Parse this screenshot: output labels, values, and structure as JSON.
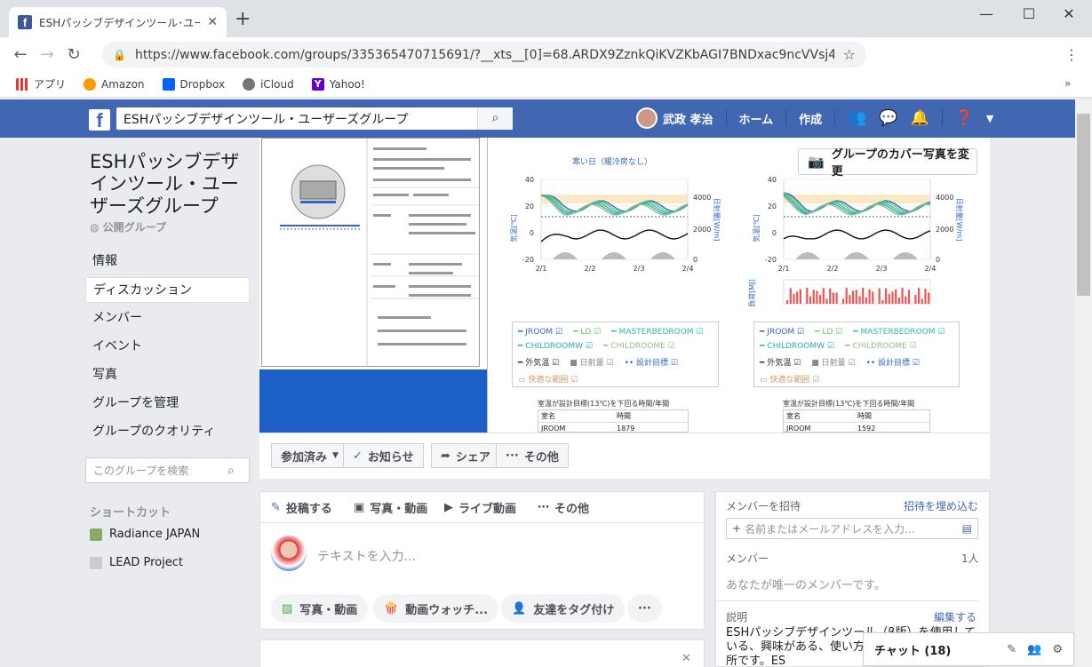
{
  "browser": {
    "tab_title": "ESHパッシブデザインツール･ユーザーズ",
    "url": "https://www.facebook.com/groups/335365470715691/?__xts__[0]=68.ARDX9ZznkQiKVZKbAGI7BNDxac9ncVVsj4qqfVlvRFebJw...",
    "bookmarks": [
      "アプリ",
      "Amazon",
      "Dropbox",
      "iCloud",
      "Yahoo!"
    ]
  },
  "fb": {
    "search_value": "ESHパッシブデザインツール・ユーザーズグループ",
    "user_name": "武政 孝治",
    "home": "ホーム",
    "create": "作成"
  },
  "group": {
    "name": "ESHパッシブデザインツール・ユーザーズグループ",
    "privacy": "公開グループ",
    "menu": [
      "情報",
      "ディスカッション",
      "メンバー",
      "イベント",
      "写真",
      "グループを管理",
      "グループのクオリティ"
    ],
    "search_placeholder": "このグループを検索",
    "shortcuts_header": "ショートカット",
    "shortcuts": [
      "Radiance JAPAN",
      "LEAD Project"
    ]
  },
  "cover": {
    "change_cover": "グループのカバー写真を変更",
    "left_chart_title": "寒い日（暖冷房なし）",
    "legend": [
      "JROOM",
      "LD",
      "MASTERBEDROOM",
      "CHILDROOMW",
      "CHILDROOME",
      "外気温",
      "日射量",
      "設計目標",
      "快適な範囲"
    ],
    "table_title": "室温が設計目標(13℃)を下回る時間/年間",
    "table_headers": [
      "室名",
      "時間"
    ],
    "table_left": [
      "JROOM",
      "1879"
    ],
    "table_right": [
      "JROOM",
      "1592"
    ],
    "x_ticks": [
      "2/1",
      "2/2",
      "2/3",
      "2/4"
    ],
    "y_ticks": [
      "40",
      "20",
      "0",
      "-20"
    ],
    "y2_ticks": [
      "4000",
      "2000",
      "0"
    ],
    "y_label": "気温[℃]",
    "y2_label": "日射量[W/m]",
    "load_label": "負荷[MJ]"
  },
  "actions": {
    "joined": "参加済み",
    "notify": "お知らせ",
    "share": "シェア",
    "more": "その他"
  },
  "composer": {
    "tabs": [
      "投稿する",
      "写真・動画",
      "ライブ動画",
      "その他"
    ],
    "placeholder": "テキストを入力...",
    "pills": [
      "写真・動画",
      "動画ウォッチ...",
      "友達をタグ付け"
    ]
  },
  "right": {
    "invite_title": "メンバーを招待",
    "invite_link": "招待を埋め込む",
    "invite_placeholder": "名前またはメールアドレスを入力...",
    "members": "メンバー",
    "member_count": "1人",
    "only_member": "あなたが唯一のメンバーです。",
    "desc": "説明",
    "edit": "編集する",
    "desc_text": "ESHパッシブデザインツール（β版）を使用している、興味がある、使い方や意見を交換する場所です。ES"
  },
  "chat": {
    "label": "チャット (18)"
  }
}
